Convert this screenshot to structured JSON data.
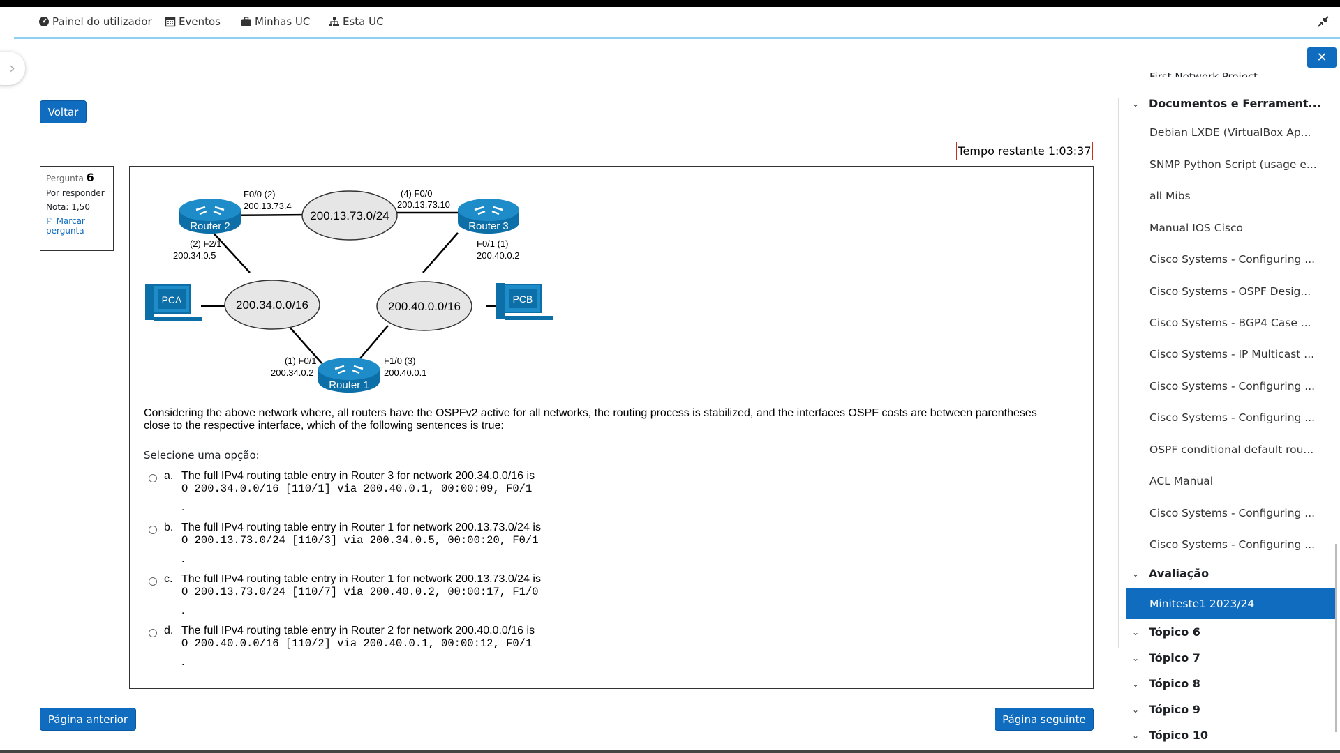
{
  "nav": {
    "items": [
      {
        "label": "Painel do utilizador",
        "icon": "dashboard-icon"
      },
      {
        "label": "Eventos",
        "icon": "calendar-icon"
      },
      {
        "label": "Minhas UC",
        "icon": "briefcase-icon"
      },
      {
        "label": "Esta UC",
        "icon": "sitemap-icon"
      }
    ]
  },
  "buttons": {
    "back": "Voltar",
    "prev": "Página anterior",
    "next": "Página seguinte"
  },
  "timer": "Tempo restante 1:03:37",
  "question_info": {
    "label": "Pergunta",
    "number": "6",
    "status": "Por responder",
    "grade": "Nota: 1,50",
    "flag": "Marcar pergunta"
  },
  "diagram": {
    "clouds": [
      "200.13.73.0/24",
      "200.34.0.0/16",
      "200.40.0.0/16"
    ],
    "routers": [
      "Router 1",
      "Router 2",
      "Router 3"
    ],
    "pcs": [
      "PCA",
      "PCB"
    ],
    "labels": {
      "r2_f00": "F0/0 (2)",
      "r2_f00_ip": "200.13.73.4",
      "r3_f00": "(4) F0/0",
      "r3_f00_ip": "200.13.73.10",
      "r2_f21": "(2) F2/1",
      "r2_f21_ip": "200.34.0.5",
      "r3_f01": "F0/1 (1)",
      "r3_f01_ip": "200.40.0.2",
      "r1_f01": "(1) F0/1",
      "r1_f01_ip": "200.34.0.2",
      "r1_f10": "F1/0 (3)",
      "r1_f10_ip": "200.40.0.1"
    }
  },
  "question_text": "Considering the above network where, all routers have the OSPFv2 active for all networks, the routing process is stabilized, and the interfaces OSPF costs are between parentheses close to the respective interface, which of the following sentences is true:",
  "prompt": "Selecione uma opção:",
  "options": [
    {
      "letter": "a.",
      "text": "The full IPv4 routing table entry in Router 3 for network 200.34.0.0/16 is",
      "code": "O 200.34.0.0/16 [110/1] via 200.40.0.1, 00:00:09, F0/1",
      "tail": "."
    },
    {
      "letter": "b.",
      "text": "The full IPv4 routing table entry in Router 1 for network 200.13.73.0/24 is",
      "code": "O 200.13.73.0/24 [110/3] via 200.34.0.5, 00:00:20, F0/1",
      "tail": "."
    },
    {
      "letter": "c.",
      "text": "The full IPv4 routing table entry in Router 1 for network 200.13.73.0/24 is",
      "code": "O 200.13.73.0/24 [110/7] via 200.40.0.2, 00:00:17, F1/0",
      "tail": "."
    },
    {
      "letter": "d.",
      "text": "The full IPv4 routing table entry in Router 2 for network 200.40.0.0/16 is",
      "code": "O 200.40.0.0/16 [110/2] via 200.40.0.1, 00:00:12, F0/1",
      "tail": "."
    }
  ],
  "sidebar": {
    "cut_item": "First Network Project",
    "section_docs": "Documentos e Ferrament...",
    "items": [
      "Debian LXDE (VirtualBox Ap...",
      "SNMP Python Script (usage e...",
      "all Mibs",
      "Manual IOS Cisco",
      "Cisco Systems - Configuring ...",
      "Cisco Systems - OSPF Desig...",
      "Cisco Systems - BGP4 Case ...",
      "Cisco Systems - IP Multicast ...",
      "Cisco Systems - Configuring ...",
      "Cisco Systems - Configuring ...",
      "OSPF conditional default rou...",
      "ACL Manual",
      "Cisco Systems - Configuring ...",
      "Cisco Systems - Configuring ..."
    ],
    "section_eval": "Avaliação",
    "active_item": "Miniteste1 2023/24",
    "topics": [
      "Tópico 6",
      "Tópico 7",
      "Tópico 8",
      "Tópico 9",
      "Tópico 10"
    ],
    "close_icon": "close-icon"
  }
}
